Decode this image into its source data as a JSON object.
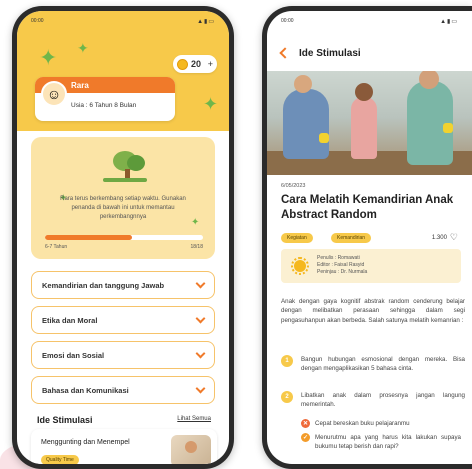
{
  "colors": {
    "accent": "#f07a2a",
    "yellow": "#f7c94a",
    "cream": "#fbe4a6",
    "leaf": "#6fb64a"
  },
  "left_screen": {
    "status_time": "00:00",
    "status_icons": "▲▮▭",
    "coins": {
      "value": "20",
      "plus": "+"
    },
    "profile": {
      "name": "Rara",
      "age": "Usia : 6 Tahun 8 Bulan",
      "avatar_icon": "girl-avatar-icon"
    },
    "progress": {
      "text": "Rara terus berkembang setiap waktu. Gunakan penanda di bawah ini untuk memantau perkembangnnya",
      "fraction": 0.55,
      "range_start": "6-7 Tahun",
      "range_end": "18/18"
    },
    "categories": [
      {
        "label": "Kemandirian dan tanggung Jawab"
      },
      {
        "label": "Etika dan Moral"
      },
      {
        "label": "Emosi dan Sosial"
      },
      {
        "label": "Bahasa dan Komunikasi"
      }
    ],
    "section_title": "Ide Stimulasi",
    "see_all": "Lihat Semua",
    "stimulus_card": {
      "title": "Menggunting dan Menempel",
      "tag": "Quality Time"
    }
  },
  "right_screen": {
    "status_time": "00:00",
    "status_icons": "▲▮▭",
    "header_title": "Ide Stimulasi",
    "date": "6/05/2023",
    "article_title": "Cara Melatih Kemandirian Anak Abstract Random",
    "tags": [
      "Kegiatan",
      "Kemandirian"
    ],
    "likes": "1.300",
    "credits": [
      "Penulis : Romawati",
      "Editor : Faisal Rasyid",
      "Peninjau : Dr. Nurmala"
    ],
    "body": "Anak dengan gaya kognitif abstrak random cenderung belajar dengan melibatkan perasaan sehingga dalam segi pengasuhanpun akan berbeda. Salah satunya melatih kemanrian :",
    "items": [
      {
        "number": "1",
        "text": "Bangun hubungan esmosional dengan mereka. Bisa dengan mengaplikasikan 5 bahasa cinta."
      },
      {
        "number": "2",
        "text": "Libatkan anak dalam prosesnya jangan langung memerintah."
      }
    ],
    "bullets": [
      {
        "type": "x",
        "icon": "cross-icon",
        "text": "Cepat bereskan buku pelajaranmu"
      },
      {
        "type": "ok",
        "icon": "check-icon",
        "text": "Menurutmu apa yang harus kita lakukan supaya bukumu tetap berish dan rapi?"
      }
    ]
  }
}
